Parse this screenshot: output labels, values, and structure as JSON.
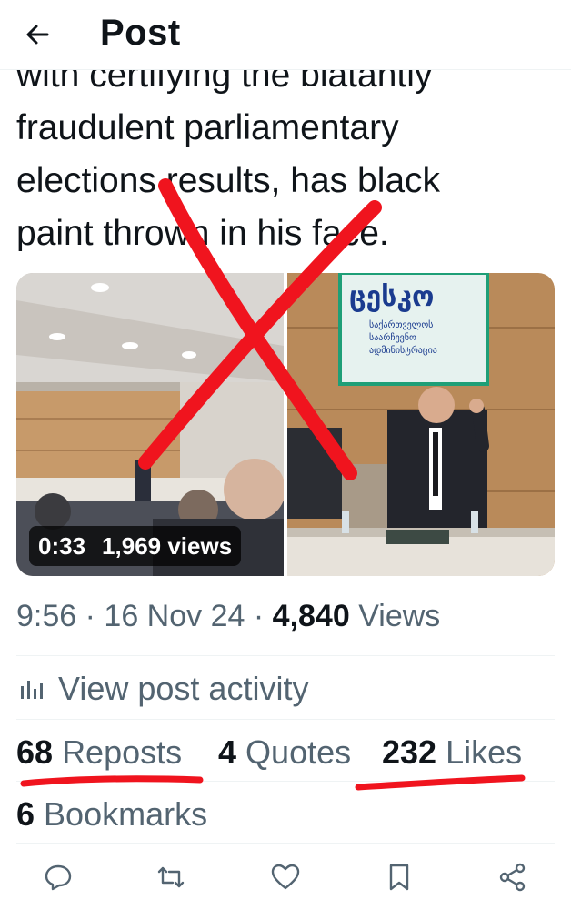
{
  "header": {
    "back_icon": "arrow-left-icon",
    "title": "Post"
  },
  "post": {
    "text_lines": [
      "with certifying the blatantly",
      "fraudulent parliamentary",
      "elections results, has black",
      "paint thrown in his face."
    ]
  },
  "media": {
    "video_duration": "0:33",
    "video_views": "1,969 views",
    "sign_title": "ცესკო",
    "sign_line1": "საქართველოს",
    "sign_line2": "საარჩევნო",
    "sign_line3": "ადმინისტრაცია"
  },
  "meta": {
    "time": "9:56",
    "date": "16 Nov 24",
    "views_count": "4,840",
    "views_label": "Views",
    "sep": "·"
  },
  "activity": {
    "icon": "bar-chart-icon",
    "label": "View post activity"
  },
  "stats": {
    "reposts_count": "68",
    "reposts_label": "Reposts",
    "quotes_count": "4",
    "quotes_label": "Quotes",
    "likes_count": "232",
    "likes_label": "Likes",
    "bookmarks_count": "6",
    "bookmarks_label": "Bookmarks"
  },
  "actions": [
    "reply-icon",
    "repost-icon",
    "like-icon",
    "bookmark-icon",
    "share-icon"
  ],
  "colors": {
    "annotation_red": "#f0141e",
    "secondary_text": "#536471",
    "primary_text": "#0f1419"
  }
}
